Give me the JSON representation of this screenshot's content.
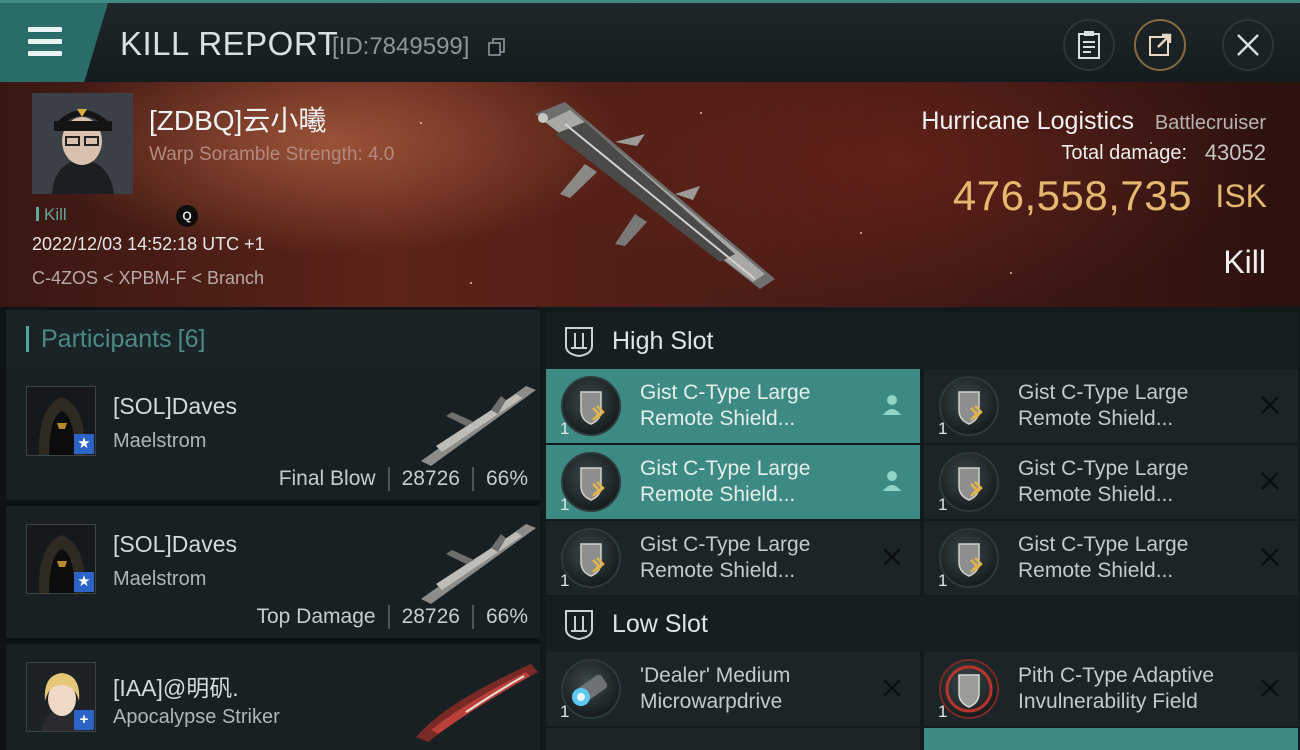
{
  "topbar": {
    "title": "KILL REPORT",
    "report_id": "[ID:7849599]"
  },
  "victim": {
    "name": "[ZDBQ]云小曦",
    "warp_scramble": "Warp Soramble Strength: 4.0",
    "kill_tag": "Kill",
    "badge": "Q",
    "datetime": "2022/12/03 14:52:18 UTC +1",
    "location": "C-4ZOS < XPBM-F < Branch"
  },
  "ship": {
    "name": "Hurricane Logistics",
    "class": "Battlecruiser",
    "damage_label": "Total damage:",
    "damage_value": "43052",
    "isk_value": "476,558,735",
    "isk_unit": "ISK",
    "result": "Kill"
  },
  "participants": {
    "label": "Participants",
    "count": "[6]",
    "rows": [
      {
        "name": "[SOL]Daves",
        "ship": "Maelstrom",
        "role": "Final Blow",
        "damage": "28726",
        "percent": "66%",
        "badge": "★"
      },
      {
        "name": "[SOL]Daves",
        "ship": "Maelstrom",
        "role": "Top Damage",
        "damage": "28726",
        "percent": "66%",
        "badge": "★"
      },
      {
        "name": "[IAA]@明矾.",
        "ship": "Apocalypse Striker",
        "badge": "+"
      }
    ]
  },
  "fitting": {
    "high_slot_title": "High Slot",
    "low_slot_title": "Low Slot",
    "high_modules": [
      {
        "line1": "Gist C-Type Large",
        "line2": "Remote Shield...",
        "qty": "1"
      },
      {
        "line1": "Gist C-Type Large",
        "line2": "Remote Shield...",
        "qty": "1"
      },
      {
        "line1": "Gist C-Type Large",
        "line2": "Remote Shield...",
        "qty": "1"
      },
      {
        "line1": "Gist C-Type Large",
        "line2": "Remote Shield...",
        "qty": "1"
      },
      {
        "line1": "Gist C-Type Large",
        "line2": "Remote Shield...",
        "qty": "1"
      },
      {
        "line1": "Gist C-Type Large",
        "line2": "Remote Shield...",
        "qty": "1"
      }
    ],
    "low_modules": [
      {
        "line1": "'Dealer' Medium",
        "line2": "Microwarpdrive",
        "qty": "1"
      },
      {
        "line1": "Pith C-Type Adaptive",
        "line2": "Invulnerability Field",
        "qty": "1"
      }
    ]
  },
  "colors": {
    "accent": "#3d8a82",
    "isk": "#e4b86f",
    "badge_blue": "#2b63c6"
  }
}
